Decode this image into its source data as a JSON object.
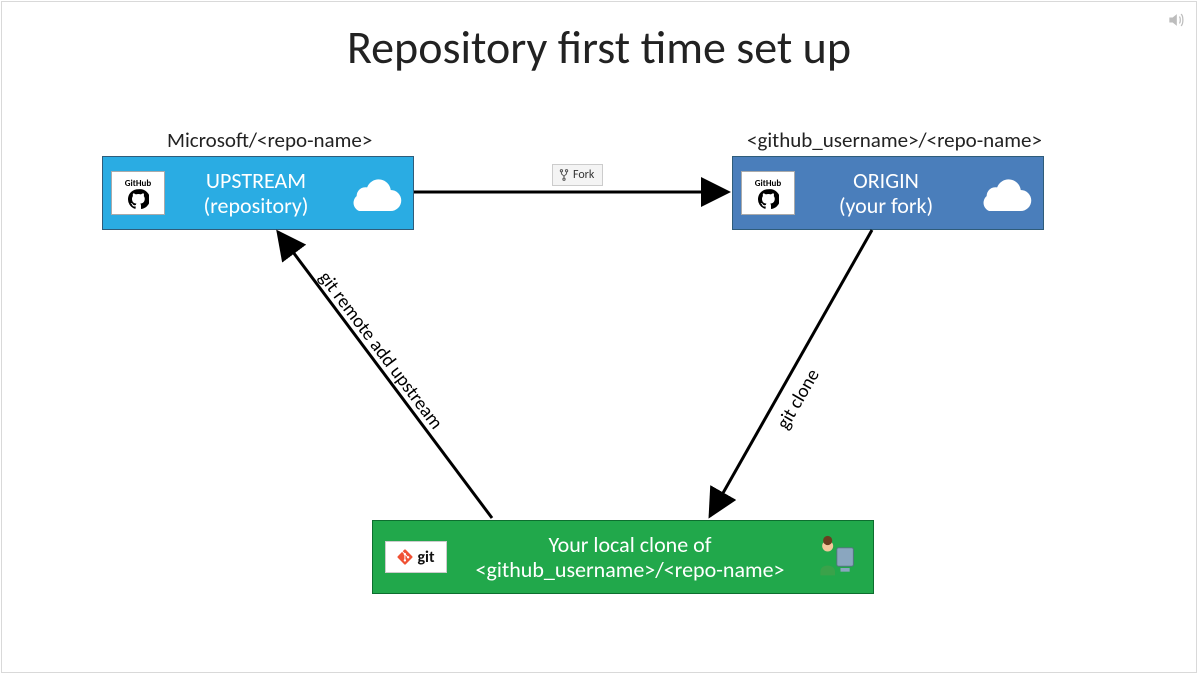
{
  "title": "Repository first time set up",
  "upstream": {
    "path_label": "Microsoft/<repo-name>",
    "title_line1": "UPSTREAM",
    "title_line2": "(repository)",
    "badge": "GitHub"
  },
  "origin": {
    "path_label": "<github_username>/<repo-name>",
    "title_line1": "ORIGIN",
    "title_line2": "(your fork)",
    "badge": "GitHub"
  },
  "local": {
    "line1": "Your local clone of",
    "line2": "<github_username>/<repo-name>",
    "git_label": "git"
  },
  "arrows": {
    "fork_button": "Fork",
    "clone_label": "git clone",
    "remote_label": "git remote add upstream"
  },
  "icons": {
    "cloud": "cloud-icon",
    "github": "github-octocat-icon",
    "git": "git-logo-icon",
    "fork": "fork-icon",
    "user_pc": "user-at-computer-icon",
    "sound": "sound-icon"
  },
  "colors": {
    "upstream_bg": "#2aace3",
    "origin_bg": "#4a7ebb",
    "local_bg": "#21a84b"
  }
}
